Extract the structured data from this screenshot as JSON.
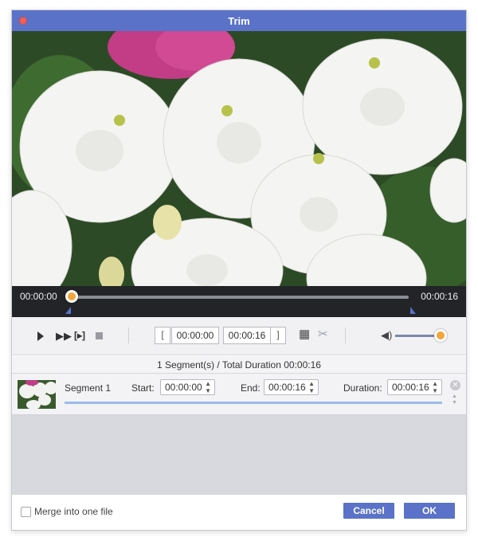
{
  "window": {
    "title": "Trim"
  },
  "timeline": {
    "current_time": "00:00:00",
    "end_time": "00:00:16",
    "playhead_position": 0.0
  },
  "controls": {
    "start_bracket": "[",
    "start_time": "00:00:00",
    "end_time": "00:00:16",
    "end_bracket": "]",
    "volume_level": 0.88
  },
  "summary": {
    "text": "1 Segment(s) / Total Duration 00:00:16"
  },
  "segments": [
    {
      "label": "Segment 1",
      "start_label": "Start:",
      "start": "00:00:00",
      "end_label": "End:",
      "end": "00:00:16",
      "duration_label": "Duration:",
      "duration": "00:00:16"
    }
  ],
  "footer": {
    "merge_label": "Merge into one file",
    "merge_checked": false,
    "cancel_label": "Cancel",
    "ok_label": "OK"
  },
  "colors": {
    "accent": "#5a72c8",
    "playhead": "#f2a53a",
    "timeline_bg": "#222427"
  },
  "icons": [
    "close-icon",
    "play-icon",
    "fast-forward-icon",
    "step-frame-icon",
    "stop-icon",
    "clip-icon",
    "cut-icon",
    "volume-icon",
    "remove-icon",
    "reorder-icon"
  ]
}
